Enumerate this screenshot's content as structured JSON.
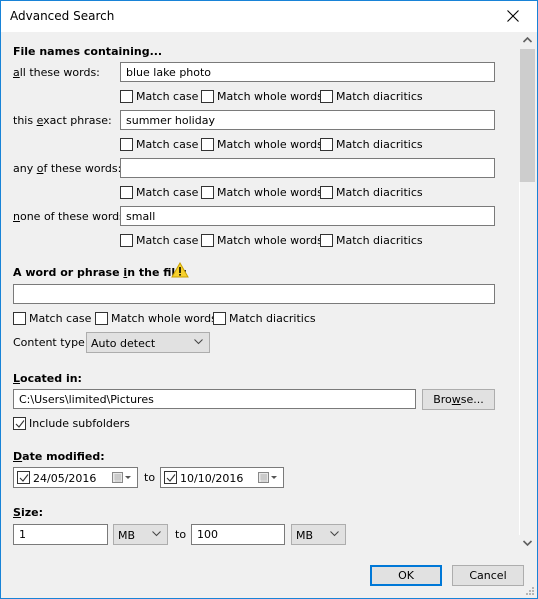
{
  "window": {
    "title": "Advanced Search"
  },
  "filenames": {
    "heading": "File names containing...",
    "rows": [
      {
        "label_pre": "",
        "label_u": "a",
        "label_post": "ll these words:",
        "value": "blue lake photo"
      },
      {
        "label_pre": "this ",
        "label_u": "e",
        "label_post": "xact phrase:",
        "value": "summer holiday"
      },
      {
        "label_pre": "any ",
        "label_u": "o",
        "label_post": "f these words:",
        "value": ""
      },
      {
        "label_pre": "",
        "label_u": "n",
        "label_post": "one of these words:",
        "value": "small"
      }
    ],
    "options": [
      "Match case",
      "Match whole words",
      "Match diacritics"
    ]
  },
  "content": {
    "heading_pre": "A word or phrase ",
    "heading_u": "i",
    "heading_post": "n the file:",
    "warning_icon": "warning-icon",
    "value": "",
    "options": [
      "Match case",
      "Match whole words",
      "Match diacritics"
    ],
    "content_type_label": "Content type:",
    "content_type_value": "Auto detect"
  },
  "location": {
    "heading_u": "L",
    "heading_post": "ocated in:",
    "path": "C:\\Users\\limited\\Pictures",
    "browse_pre": "Bro",
    "browse_u": "w",
    "browse_post": "se...",
    "include_subfolders": "Include subfolders",
    "include_subfolders_checked": true
  },
  "date": {
    "heading_u": "D",
    "heading_post": "ate modified:",
    "from": "24/05/2016",
    "from_checked": true,
    "to_label": "to",
    "to": "10/10/2016",
    "to_checked": true
  },
  "size": {
    "heading_u": "S",
    "heading_post": "ize:",
    "from": "1",
    "from_unit": "MB",
    "to_label": "to",
    "to": "100",
    "to_unit": "MB"
  },
  "buttons": {
    "ok": "OK",
    "cancel": "Cancel"
  }
}
